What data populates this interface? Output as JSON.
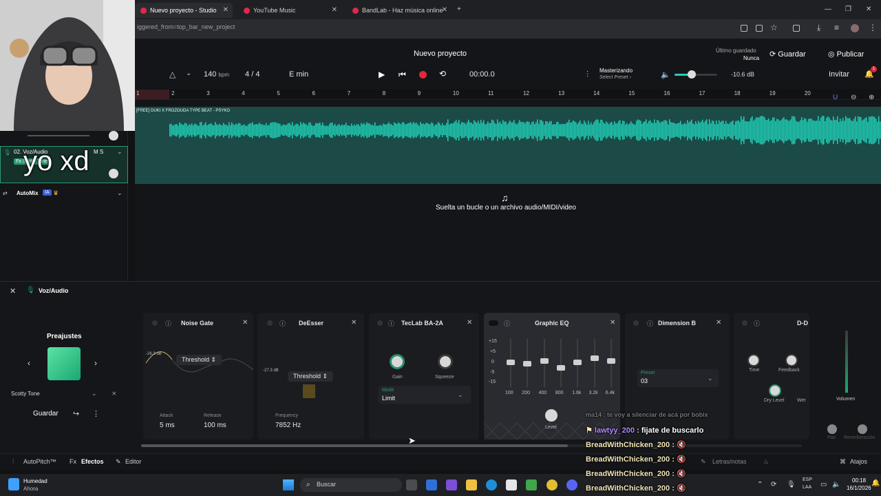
{
  "browser": {
    "tabs": [
      {
        "label": "Nuevo proyecto - Studio",
        "active": true
      },
      {
        "label": "YouTube Music",
        "active": false
      },
      {
        "label": "BandLab - Haz música online",
        "active": false
      }
    ],
    "url_fragment": "iggered_from=top_bar_new_project"
  },
  "header": {
    "project_title": "Nuevo proyecto",
    "last_saved_label": "Último guardado",
    "last_saved_value": "Nunca",
    "save": "Guardar",
    "publish": "Publicar",
    "bpm_value": "140",
    "bpm_unit": "bpm",
    "time_sig_num": "4",
    "time_sig_sep": "/",
    "time_sig_den": "4",
    "key": "E min",
    "time": "00:00.0",
    "mastering_title": "Masterizando",
    "mastering_sub": "Select Preset",
    "volume_db": "-10.6 dB",
    "invite": "Invitar",
    "notif_count": "1"
  },
  "ruler": [
    "1",
    "2",
    "3",
    "4",
    "5",
    "6",
    "7",
    "8",
    "9",
    "10",
    "11",
    "12",
    "13",
    "14",
    "15",
    "16",
    "17",
    "18",
    "19",
    "20"
  ],
  "track": {
    "clip_label": "[FREE] DUKI X FROZOUDA TYPE BEAT - PSYKO",
    "name": "02. Voz/Audio",
    "fx_badge": "Fx Scotty Tone",
    "ms": "M S",
    "automix": "AutoMix",
    "ia": "IA"
  },
  "overlay_text": "yo xd",
  "drop_hint": "Suelta un bucle o un archivo audio/MIDI/video",
  "fx_panel": {
    "track_title": "Voz/Audio",
    "presets_title": "Preajustes",
    "preset_name": "Scotty Tone",
    "save": "Guardar",
    "effects": {
      "noise_gate": {
        "title": "Noise Gate",
        "db": "-26.3 dB",
        "threshold": "Threshold",
        "attack_label": "Attack",
        "attack": "5 ms",
        "release_label": "Release",
        "release": "100 ms"
      },
      "deesser": {
        "title": "DeEsser",
        "db": "-27.3 dB",
        "threshold": "Threshold",
        "freq_label": "Frequency",
        "freq": "7852 Hz"
      },
      "teclab": {
        "title": "TecLab BA-2A",
        "gain": "Gain",
        "squeeze": "Squeeze",
        "mode_label": "Mode",
        "mode": "Limit"
      },
      "eq": {
        "title": "Graphic EQ",
        "scale": [
          "+15",
          "+5",
          "0",
          "-5",
          "-15"
        ],
        "bands": [
          "100",
          "200",
          "400",
          "800",
          "1.6k",
          "3.2k",
          "6.4k"
        ],
        "level": "Level"
      },
      "dimension": {
        "title": "Dimension B",
        "preset_label": "Preset",
        "preset": "03"
      },
      "delay": {
        "title": "D-D",
        "time": "Time",
        "feedback": "Feedback",
        "dry": "Dry Level",
        "wet": "Wet"
      }
    },
    "volume": "Volumen",
    "pan": "Pan",
    "reverb": "Reverberación"
  },
  "bottom_bar": {
    "autopitch": "AutoPitch™",
    "effects": "Efectos",
    "editor": "Editor",
    "lyrics": "Letras/notas",
    "shortcuts": "Atajos"
  },
  "taskbar": {
    "weather_title": "Humedad",
    "weather_sub": "Ahora",
    "search": "Buscar",
    "lang_top": "ESP",
    "lang_bottom": "LAA",
    "time": "00:18",
    "date": "16/1/2026"
  },
  "chat": [
    {
      "user": "ma14",
      "msg": "te voy a silenciar de acá por bobix",
      "faded": true
    },
    {
      "user": "lawtyy_200",
      "msg": "fijate de buscarlo"
    },
    {
      "user": "BreadWithChicken_200",
      "msg": ""
    },
    {
      "user": "BreadWithChicken_200",
      "msg": ""
    },
    {
      "user": "BreadWithChicken_200",
      "msg": ""
    },
    {
      "user": "BreadWithChicken_200",
      "msg": ""
    }
  ],
  "colors": {
    "accent": "#1fd1b8",
    "record": "#e0283a",
    "brand": "#e0284b"
  }
}
